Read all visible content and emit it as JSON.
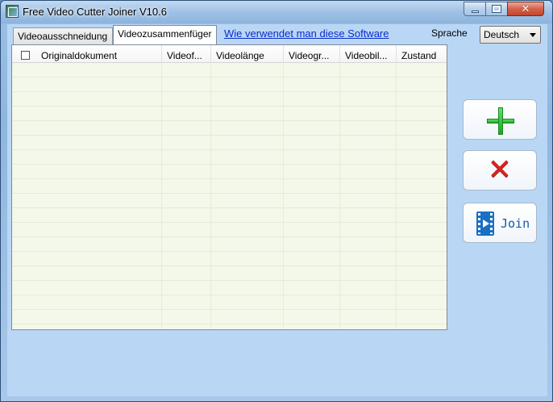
{
  "window": {
    "title": "Free Video Cutter Joiner V10.6",
    "controls": {
      "minimize": "minimize",
      "maximize": "maximize",
      "close": "close"
    }
  },
  "tabs": [
    {
      "label": "Videoausschneidung",
      "active": false
    },
    {
      "label": "Videozusammenfüger",
      "active": true
    }
  ],
  "help_link": "Wie verwendet man diese Software",
  "language": {
    "label": "Sprache",
    "selected": "Deutsch"
  },
  "file_table": {
    "columns": [
      "Originaldokument",
      "Videof...",
      "Videolänge",
      "Videogr...",
      "Videobil...",
      "Zustand"
    ],
    "rows": []
  },
  "actions": {
    "add": {
      "icon": "plus-icon"
    },
    "remove": {
      "icon": "cross-icon"
    },
    "join": {
      "icon": "film-icon",
      "label": "Join"
    }
  },
  "colors": {
    "add_green": "#2bb834",
    "remove_red": "#d9231f",
    "join_blue": "#1a6fc4",
    "link_blue": "#0a2ccf"
  }
}
